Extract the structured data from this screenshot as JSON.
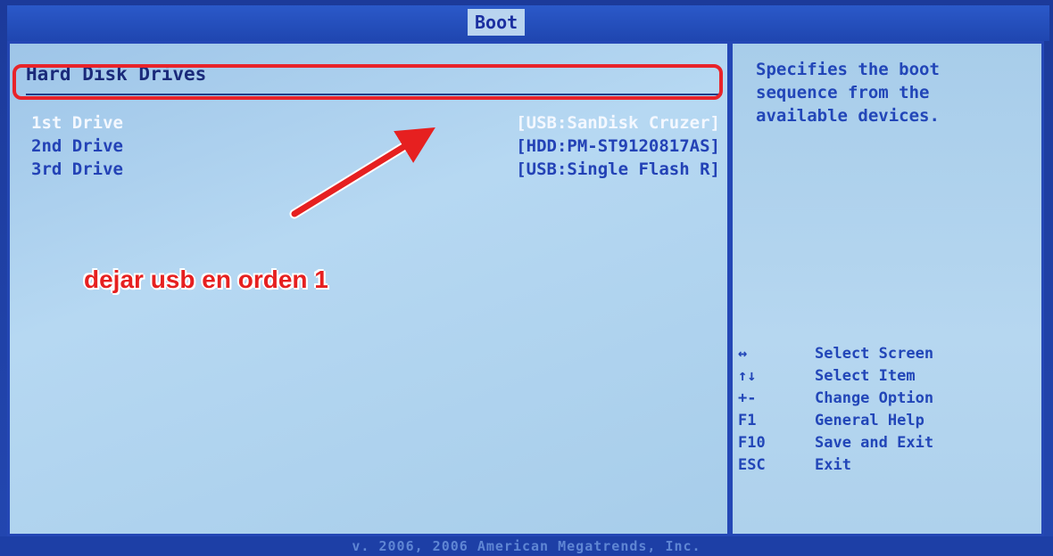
{
  "header": {
    "active_tab": "Boot"
  },
  "main": {
    "section_title": "Hard Disk Drives",
    "drives": [
      {
        "label": "1st Drive",
        "value": "[USB:SanDisk Cruzer]",
        "selected": true
      },
      {
        "label": "2nd Drive",
        "value": "[HDD:PM-ST9120817AS]",
        "selected": false
      },
      {
        "label": "3rd Drive",
        "value": "[USB:Single Flash R]",
        "selected": false
      }
    ]
  },
  "help": {
    "description": "Specifies the boot\nsequence from the\navailable devices.",
    "keys": [
      {
        "key": "↔",
        "desc": "Select Screen"
      },
      {
        "key": "↑↓",
        "desc": "Select Item"
      },
      {
        "key": "+-",
        "desc": "Change Option"
      },
      {
        "key": "F1",
        "desc": "General Help"
      },
      {
        "key": "F10",
        "desc": "Save and Exit"
      },
      {
        "key": "ESC",
        "desc": "Exit"
      }
    ]
  },
  "footer": {
    "text": "v. 2006, 2006 American Megatrends, Inc."
  },
  "overlay": {
    "annotation": "dejar usb en orden 1",
    "highlight_color": "#e8232a"
  }
}
